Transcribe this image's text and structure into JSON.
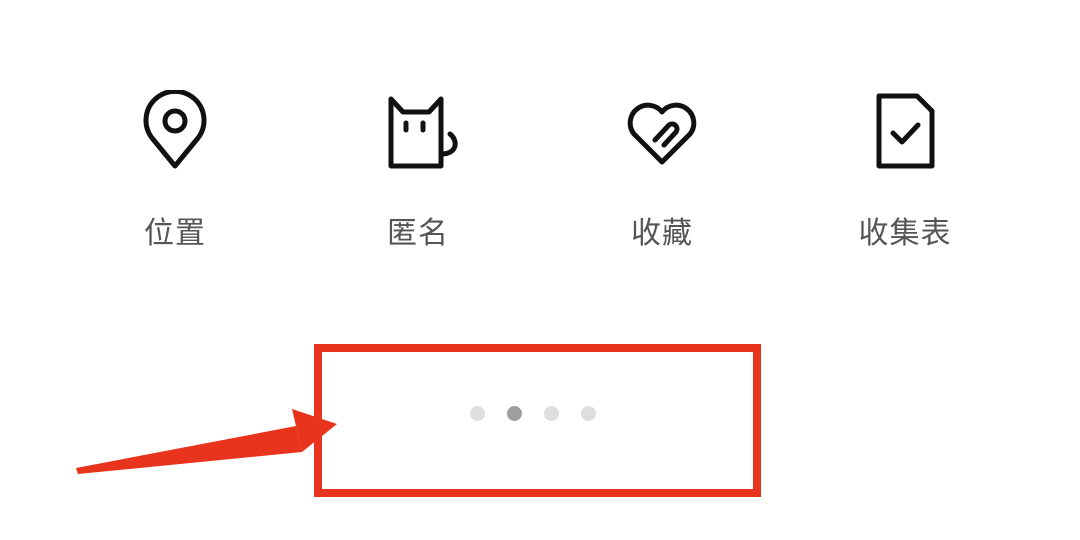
{
  "tools": [
    {
      "label": "位置",
      "icon": "location-pin-icon"
    },
    {
      "label": "匿名",
      "icon": "cat-icon"
    },
    {
      "label": "收藏",
      "icon": "heart-paperclip-icon"
    },
    {
      "label": "收集表",
      "icon": "document-check-icon"
    }
  ],
  "pager": {
    "page_count": 4,
    "active_index": 1
  },
  "colors": {
    "annotation": "#e8341c",
    "label": "#555555",
    "dot_inactive": "#dedede",
    "dot_active": "#9e9e9e"
  }
}
